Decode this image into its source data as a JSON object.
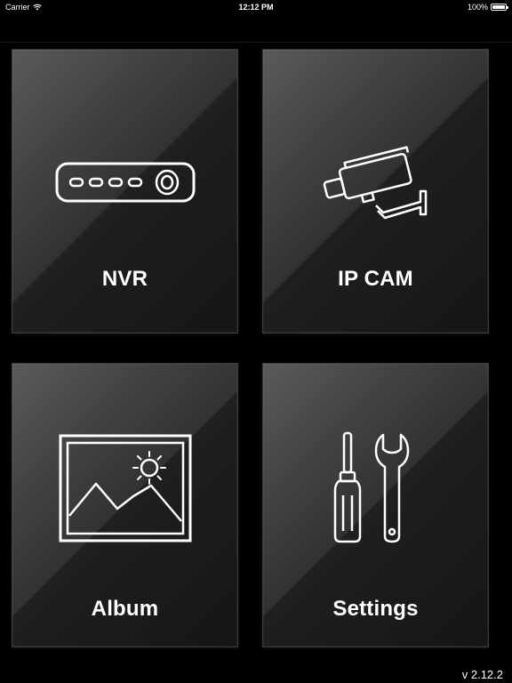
{
  "status_bar": {
    "carrier": "Carrier",
    "time": "12:12 PM",
    "battery": "100%"
  },
  "tiles": [
    {
      "label": "NVR",
      "icon": "nvr-recorder-icon"
    },
    {
      "label": "IP CAM",
      "icon": "ip-camera-icon"
    },
    {
      "label": "Album",
      "icon": "picture-icon"
    },
    {
      "label": "Settings",
      "icon": "tools-icon"
    }
  ],
  "footer": {
    "version": "v 2.12.2"
  }
}
